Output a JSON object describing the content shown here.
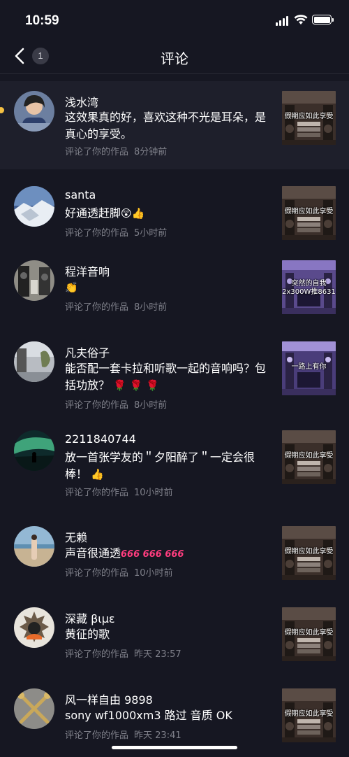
{
  "status_bar": {
    "time": "10:59"
  },
  "nav": {
    "back_badge_count": "1",
    "title": "评论"
  },
  "comments": [
    {
      "username": "浅水湾",
      "text": "这效果真的好，喜欢这种不光是耳朵，是真心的享受。",
      "action": "评论了你的作品",
      "time": "8分钟前",
      "thumb_caption": "假期应如此享受",
      "unread": true
    },
    {
      "username": "santa",
      "text": "好通透赶脚",
      "emojis": "😲👍",
      "action": "评论了你的作品",
      "time": "5小时前",
      "thumb_caption": "假期应如此享受"
    },
    {
      "username": "程洋音响",
      "text": "",
      "emojis": "👏",
      "action": "评论了你的作品",
      "time": "8小时前",
      "thumb_caption": "突然的自我 2x300W推8631"
    },
    {
      "username": "凡夫俗子",
      "text": "能否配一套卡拉和听歌一起的音响吗？包括功放？",
      "emojis": "🌹 🌹 🌹",
      "action": "评论了你的作品",
      "time": "8小时前",
      "thumb_caption": "一路上有你"
    },
    {
      "username": "2211840744",
      "text": "放一首张学友的＂夕阳醉了＂一定会很棒！",
      "emojis": "👍",
      "action": "评论了你的作品",
      "time": "10小时前",
      "thumb_caption": "假期应如此享受"
    },
    {
      "username": "无赖",
      "text": "声音很通透",
      "emojis": "666 666 666",
      "action": "评论了你的作品",
      "time": "10小时前",
      "thumb_caption": "假期应如此享受"
    },
    {
      "username": "深藏 βιμε",
      "text": "黄征的歌",
      "action": "评论了你的作品",
      "time": "昨天 23:57",
      "thumb_caption": "假期应如此享受"
    },
    {
      "username": "风一样自由 9898",
      "text": "sony wf1000xm3 路过 音质 OK",
      "action": "评论了你的作品",
      "time": "昨天 23:41",
      "thumb_caption": "假期应如此享受"
    }
  ],
  "colors": {
    "background": "#161722",
    "highlight_row": "#1e1f2b",
    "meta_text": "#7f808a",
    "unread_dot": "#f6c143",
    "emoji_666": "#ff3d7f"
  }
}
